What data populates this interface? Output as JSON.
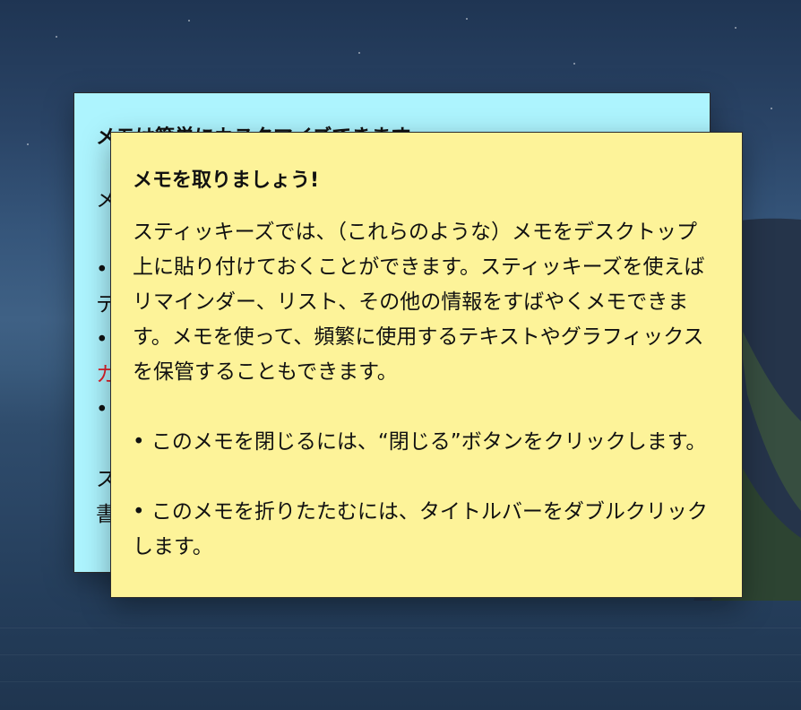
{
  "desktop": {
    "wallpaper": "night-sea-island"
  },
  "notes": {
    "back": {
      "color": "#adf4fe",
      "title": "メモは簡単にカスタマイズできます",
      "lines": [
        "メ",
        "•",
        "テ",
        "•",
        "カ",
        "•",
        "ス",
        "書"
      ],
      "red_line_color": "#e0202a"
    },
    "front": {
      "color": "#fdf399",
      "title": "メモを取りましょう!",
      "paragraph1": "スティッキーズでは、（これらのような）メモをデスクトップ上に貼り付けておくことができます。スティッキーズを使えばリマインダー、リスト、その他の情報をすばやくメモできます。メモを使って、頻繁に使用するテキストやグラフィックスを保管することもできます。",
      "bullet1": "• このメモを閉じるには、“閉じる”ボタンをクリックします。",
      "bullet2": "• このメモを折りたたむには、タイトルバーをダブルクリックします。"
    }
  }
}
